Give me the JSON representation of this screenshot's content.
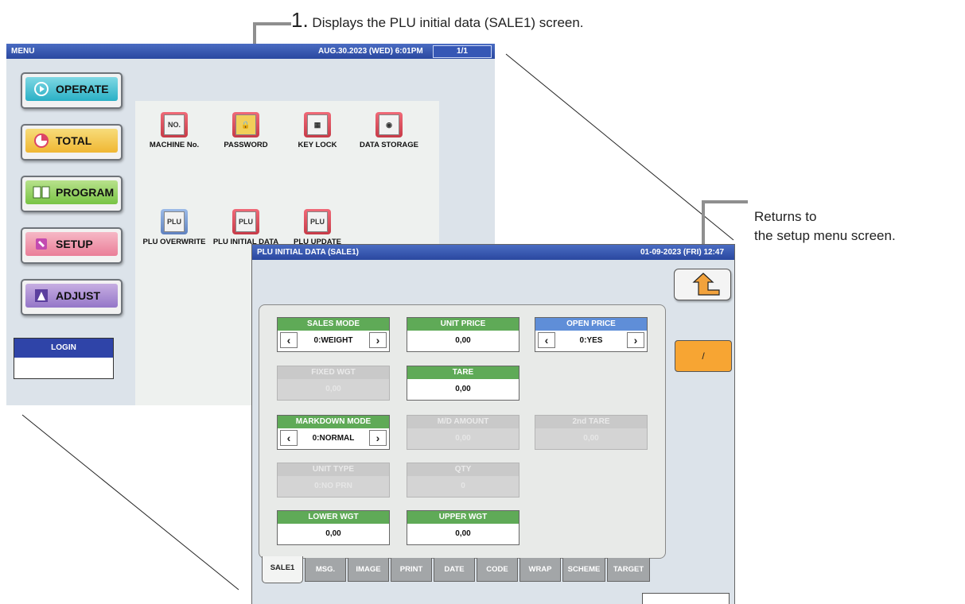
{
  "callouts": {
    "step1_number": "1.",
    "step1_text": "Displays the PLU initial data (SALE1) screen.",
    "return_line1": "Returns to",
    "return_line2": "the setup menu screen."
  },
  "menu_screen": {
    "title": "MENU",
    "datetime": "AUG.30.2023 (WED)  6:01PM",
    "page": "1/1",
    "side_buttons": [
      {
        "label": "OPERATE",
        "color": "#4fc4d6"
      },
      {
        "label": "TOTAL",
        "color": "#f1c443"
      },
      {
        "label": "PROGRAM",
        "color": "#8fcf58"
      },
      {
        "label": "SETUP",
        "color": "#ef93a8"
      },
      {
        "label": "ADJUST",
        "color": "#a98ad1"
      }
    ],
    "login_label": "LOGIN",
    "items": [
      {
        "label": "MACHINE No.",
        "icon": "NO."
      },
      {
        "label": "PASSWORD",
        "icon": "lock"
      },
      {
        "label": "KEY LOCK",
        "icon": "keys"
      },
      {
        "label": "DATA STORAGE",
        "icon": "disk"
      },
      {
        "label": "PLU OVERWRITE",
        "icon": "PLU"
      },
      {
        "label": "PLU INITIAL DATA",
        "icon": "PLU"
      },
      {
        "label": "PLU UPDATE",
        "icon": "PLU"
      }
    ]
  },
  "plu_screen": {
    "title": "PLU INITIAL DATA (SALE1)",
    "datetime": "01-09-2023 (FRI) 12:47",
    "side_button": "/",
    "fields": {
      "sales_mode": {
        "label": "SALES MODE",
        "value": "0:WEIGHT"
      },
      "unit_price": {
        "label": "UNIT PRICE",
        "value": "0,00"
      },
      "open_price": {
        "label": "OPEN PRICE",
        "value": "0:YES"
      },
      "fixed_wgt": {
        "label": "FIXED WGT",
        "value": "0,00"
      },
      "tare": {
        "label": "TARE",
        "value": "0,00"
      },
      "markdown_mode": {
        "label": "MARKDOWN MODE",
        "value": "0:NORMAL"
      },
      "md_amount": {
        "label": "M/D AMOUNT",
        "value": "0,00"
      },
      "second_tare": {
        "label": "2nd TARE",
        "value": "0,00"
      },
      "unit_type": {
        "label": "UNIT TYPE",
        "value": "0:NO PRN"
      },
      "qty": {
        "label": "QTY",
        "value": "0"
      },
      "lower_wgt": {
        "label": "LOWER WGT",
        "value": "0,00"
      },
      "upper_wgt": {
        "label": "UPPER WGT",
        "value": "0,00"
      }
    },
    "tabs": [
      "SALE1",
      "MSG.",
      "IMAGE",
      "PRINT",
      "DATE",
      "CODE",
      "WRAP",
      "SCHEME",
      "TARGET"
    ]
  }
}
